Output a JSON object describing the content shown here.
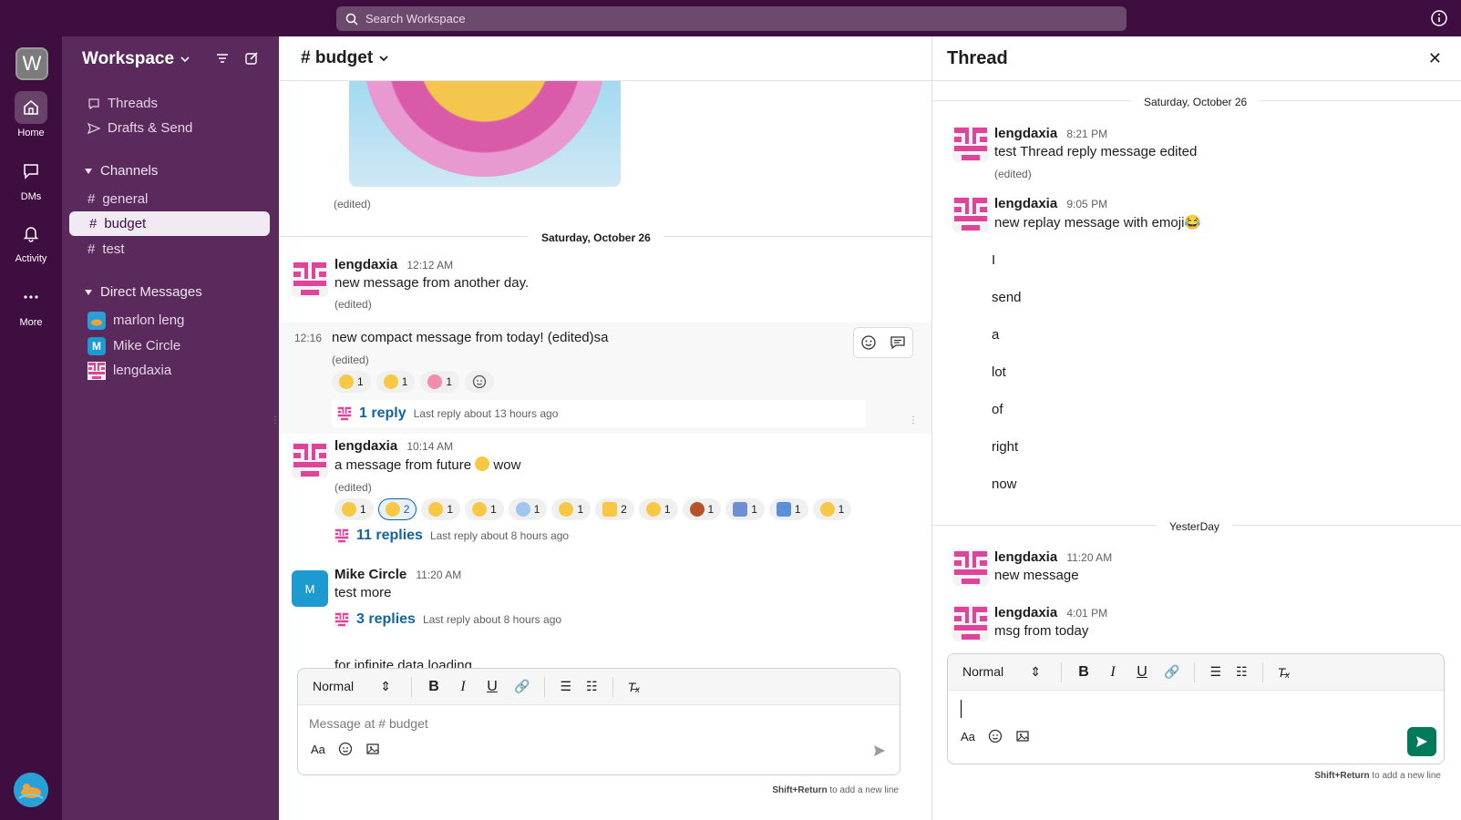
{
  "search": {
    "placeholder": "Search Workspace"
  },
  "rail": {
    "workspace_initial": "W",
    "items": [
      {
        "label": "Home",
        "icon": "home-icon"
      },
      {
        "label": "DMs",
        "icon": "message-icon"
      },
      {
        "label": "Activity",
        "icon": "bell-icon"
      },
      {
        "label": "More",
        "icon": "ellipsis-icon"
      }
    ]
  },
  "sidebar": {
    "workspace_name": "Workspace",
    "nav": [
      {
        "label": "Threads"
      },
      {
        "label": "Drafts & Send"
      }
    ],
    "channels_label": "Channels",
    "channels": [
      {
        "name": "general"
      },
      {
        "name": "budget"
      },
      {
        "name": "test"
      }
    ],
    "dm_label": "Direct Messages",
    "dms": [
      {
        "name": "marlon leng",
        "initial": ""
      },
      {
        "name": "Mike Circle",
        "initial": "M"
      },
      {
        "name": "lengdaxia",
        "initial": ""
      }
    ]
  },
  "channel": {
    "name": "# budget",
    "edited_label": "(edited)",
    "day": "Saturday, October 26",
    "messages": [
      {
        "user": "lengdaxia",
        "time": "12:12 AM",
        "text": "new message from another day.",
        "edited": "(edited)"
      },
      {
        "time": "12:16",
        "text": "new compact message from today! (edited)sa",
        "edited": "(edited)",
        "reactions": [
          {
            "count": "1"
          },
          {
            "count": "1"
          },
          {
            "count": "1"
          }
        ],
        "reply_count": "1 reply",
        "reply_last": "Last reply about 13 hours ago"
      },
      {
        "user": "lengdaxia",
        "time": "10:14 AM",
        "text_a": "a message from future",
        "text_b": "wow",
        "edited": "(edited)",
        "reactions": [
          {
            "count": "1"
          },
          {
            "count": "2"
          },
          {
            "count": "1"
          },
          {
            "count": "1"
          },
          {
            "count": "1"
          },
          {
            "count": "1"
          },
          {
            "count": "2"
          },
          {
            "count": "1"
          },
          {
            "count": "1"
          },
          {
            "count": "1"
          },
          {
            "count": "1"
          },
          {
            "count": "1"
          }
        ],
        "reply_count": "11 replies",
        "reply_last": "Last reply about 8 hours ago"
      },
      {
        "user": "Mike Circle",
        "avatar_initial": "M",
        "time": "11:20 AM",
        "text": "test more",
        "reply_count": "3 replies",
        "reply_last": "Last reply about 8 hours ago"
      },
      {
        "text": "for infinite data loading"
      }
    ]
  },
  "composer": {
    "style_select": "Normal",
    "placeholder": "Message at # budget",
    "hint_bold": "Shift+Return",
    "hint_rest": "to add a new line"
  },
  "thread": {
    "title": "Thread",
    "day1": "Saturday, October 26",
    "day2": "YesterDay",
    "messages": [
      {
        "user": "lengdaxia",
        "time": "8:21 PM",
        "text": "test Thread reply message  edited",
        "edited": "(edited)"
      },
      {
        "user": "lengdaxia",
        "time": "9:05 PM",
        "text": "new replay message with emoji😂",
        "lines": [
          "I",
          "send",
          "a",
          "lot",
          "of",
          "right",
          "now"
        ]
      },
      {
        "user": "lengdaxia",
        "time": "11:20 AM",
        "text": "new message"
      },
      {
        "user": "lengdaxia",
        "time": "4:01 PM",
        "text": "msg from today"
      }
    ],
    "composer": {
      "style_select": "Normal",
      "hint_bold": "Shift+Return",
      "hint_rest": "to add a new line"
    }
  },
  "colors": {
    "aubergine": "#3f0e40",
    "sidebar": "#5a2a5c",
    "link": "#1264a3",
    "avatar_pink": "#e0439a",
    "send_green": "#007a5a"
  }
}
